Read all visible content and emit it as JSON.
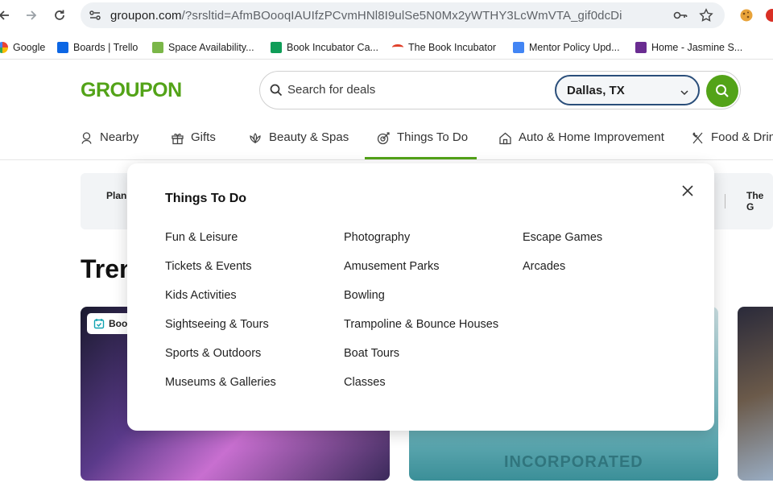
{
  "browser": {
    "url_host": "groupon.com",
    "url_path": "/?srsltid=AfmBOooqIAUIfzPCvmHNl8I9ulSe5N0Mx2yWTHY3LcWmVTA_gif0dcDi"
  },
  "bookmarks": [
    {
      "label": "Google",
      "color": "#4285f4"
    },
    {
      "label": "Boards | Trello",
      "color": "#0c66e4"
    },
    {
      "label": "Space Availability...",
      "color": "#7ab648"
    },
    {
      "label": "Book Incubator Ca...",
      "color": "#0f9d58"
    },
    {
      "label": "The Book Incubator",
      "color": "#e0402a"
    },
    {
      "label": "Mentor Policy Upd...",
      "color": "#4285f4"
    },
    {
      "label": "Home - Jasmine S...",
      "color": "#6a2c91"
    }
  ],
  "header": {
    "logo": "GROUPON",
    "search_placeholder": "Search for deals",
    "location": "Dallas, TX"
  },
  "categories": [
    {
      "label": "Nearby"
    },
    {
      "label": "Gifts"
    },
    {
      "label": "Beauty & Spas"
    },
    {
      "label": "Things To Do"
    },
    {
      "label": "Auto & Home Improvement"
    },
    {
      "label": "Food & Drink"
    }
  ],
  "page": {
    "plan_label": "Plan",
    "the_g_label": "The G",
    "trending_heading": "Trending",
    "book_badge": "Book",
    "card2_text": "INCORPORATED"
  },
  "dropdown": {
    "title": "Things To Do",
    "columns": [
      [
        "Fun & Leisure",
        "Tickets & Events",
        "Kids Activities",
        "Sightseeing & Tours",
        "Sports & Outdoors",
        "Museums & Galleries"
      ],
      [
        "Photography",
        "Amusement Parks",
        "Bowling",
        "Trampoline & Bounce Houses",
        "Boat Tours",
        "Classes"
      ],
      [
        "Escape Games",
        "Arcades"
      ]
    ]
  },
  "colors": {
    "brand_green": "#53a318",
    "location_border": "#2a4e7a"
  }
}
